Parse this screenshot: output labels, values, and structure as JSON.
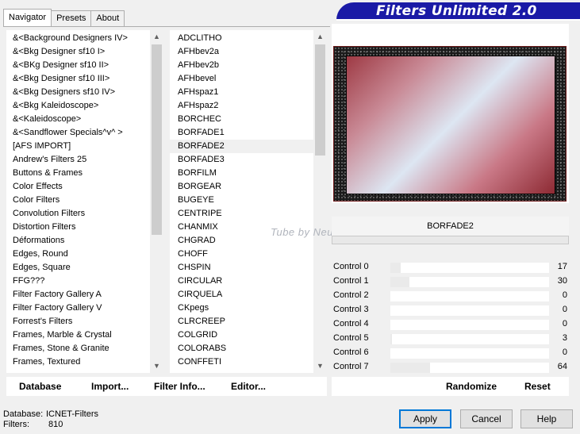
{
  "tabs": [
    {
      "label": "Navigator",
      "active": true
    },
    {
      "label": "Presets",
      "active": false
    },
    {
      "label": "About",
      "active": false
    }
  ],
  "banner": {
    "title": "Filters Unlimited 2.0"
  },
  "categories": {
    "selected_index": 8,
    "items": [
      "&<Background Designers IV>",
      "&<Bkg Designer sf10 I>",
      "&<BKg Designer sf10 II>",
      "&<Bkg Designer sf10 III>",
      "&<Bkg Designers sf10 IV>",
      "&<Bkg Kaleidoscope>",
      "&<Kaleidoscope>",
      "&<Sandflower Specials^v^ >",
      "[AFS IMPORT]",
      "Andrew's Filters 25",
      "Buttons & Frames",
      "Color Effects",
      "Color Filters",
      "Convolution Filters",
      "Distortion Filters",
      "Déformations",
      "Edges, Round",
      "Edges, Square",
      "FFG???",
      "Filter Factory Gallery A",
      "Filter Factory Gallery V",
      "Forrest's Filters",
      "Frames, Marble & Crystal",
      "Frames, Stone & Granite",
      "Frames, Textured"
    ]
  },
  "filters": {
    "selected_index": 8,
    "items": [
      "ADCLITHO",
      "AFHbev2a",
      "AFHbev2b",
      "AFHbevel",
      "AFHspaz1",
      "AFHspaz2",
      "BORCHEC",
      "BORFADE1",
      "BORFADE2",
      "BORFADE3",
      "BORFILM",
      "BORGEAR",
      "BUGEYE",
      "CENTRIPE",
      "CHANMIX",
      "CHGRAD",
      "CHOFF",
      "CHSPIN",
      "CIRCULAR",
      "CIRQUELA",
      "CKpegs",
      "CLRCREEP",
      "COLGRID",
      "COLORABS",
      "CONFFETI"
    ]
  },
  "toolbar": {
    "database": "Database",
    "import": "Import...",
    "filter_info": "Filter Info...",
    "editor": "Editor..."
  },
  "watermark": "Tube by Neusa Novaes",
  "current_filter": "BORFADE2",
  "controls": [
    {
      "label": "Control 0",
      "value": "17"
    },
    {
      "label": "Control 1",
      "value": "30"
    },
    {
      "label": "Control 2",
      "value": "0"
    },
    {
      "label": "Control 3",
      "value": "0"
    },
    {
      "label": "Control 4",
      "value": "0"
    },
    {
      "label": "Control 5",
      "value": "3"
    },
    {
      "label": "Control 6",
      "value": "0"
    },
    {
      "label": "Control 7",
      "value": "64"
    }
  ],
  "actions": {
    "randomize": "Randomize",
    "reset": "Reset"
  },
  "status": {
    "database_label": "Database:",
    "database_value": "ICNET-Filters",
    "filters_label": "Filters:",
    "filters_value": "810"
  },
  "buttons": {
    "apply": "Apply",
    "cancel": "Cancel",
    "help": "Help"
  },
  "colors": {
    "banner": "#1a1aa6",
    "focus": "#0078d7"
  }
}
